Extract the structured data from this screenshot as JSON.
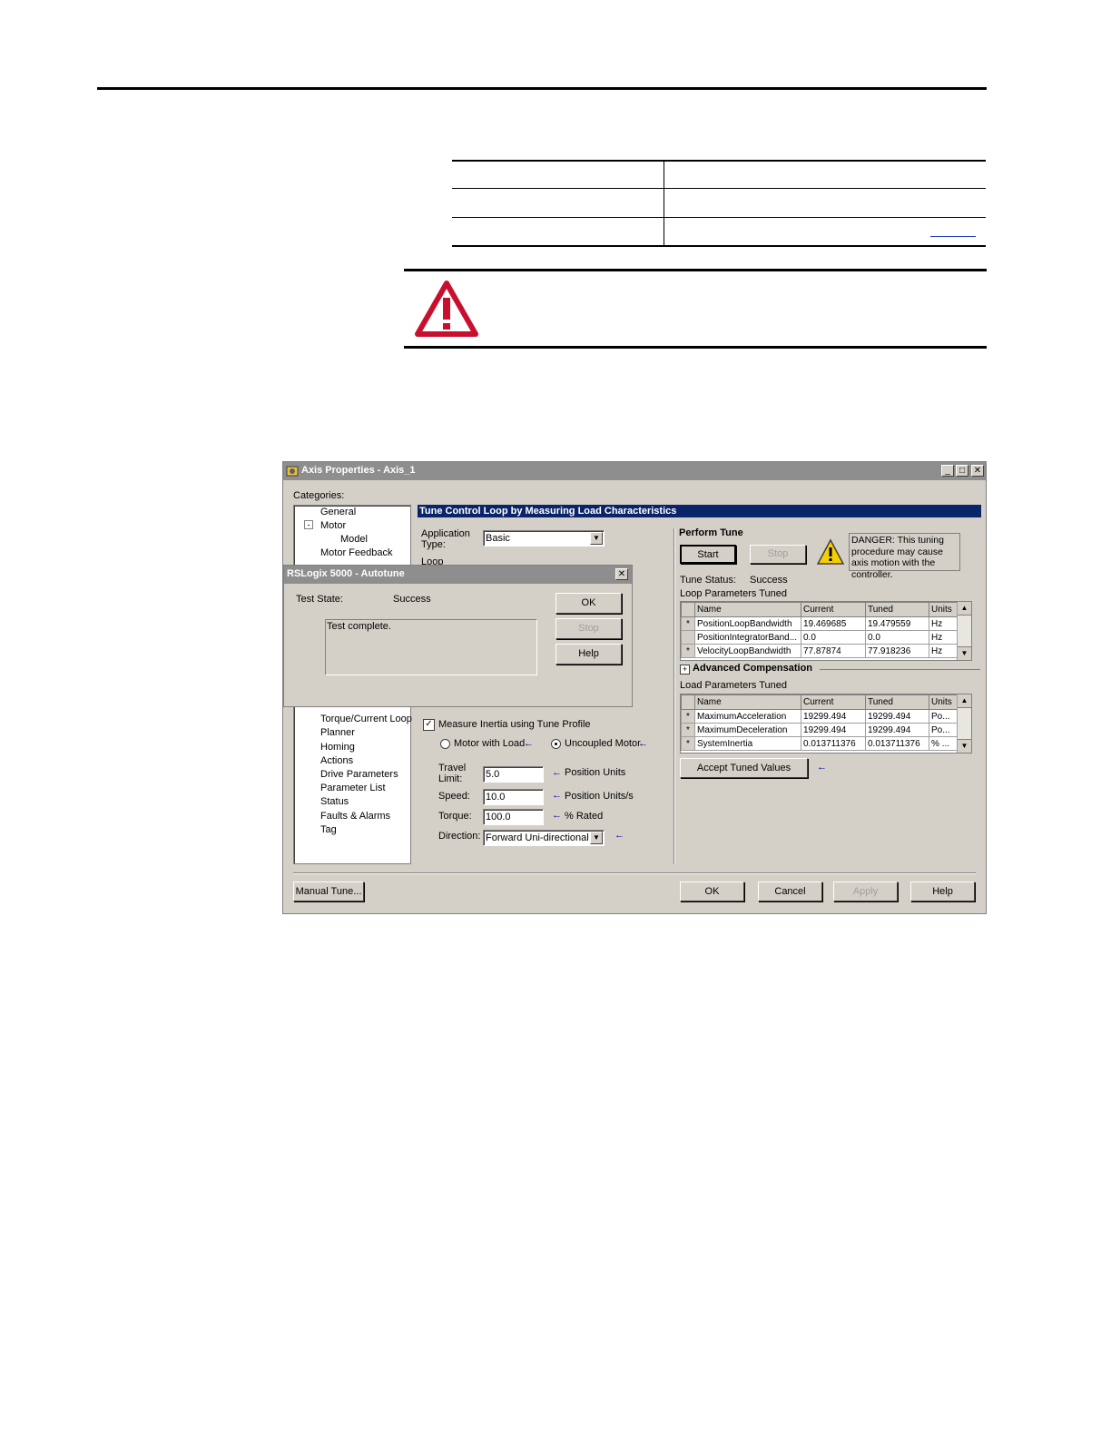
{
  "window": {
    "title": "Axis Properties - Axis_1",
    "categories_label": "Categories:",
    "categories": [
      "General",
      "Motor",
      "Model",
      "Motor Feedback",
      "Torque/Current Loop",
      "Planner",
      "Homing",
      "Actions",
      "Drive Parameters",
      "Parameter List",
      "Status",
      "Faults & Alarms",
      "Tag"
    ],
    "panel_title": "Tune Control Loop by Measuring Load Characteristics",
    "application_type_label": "Application Type:",
    "application_type_value": "Basic",
    "loop_label": "Loop",
    "measure_inertia_label": "Measure Inertia using Tune Profile",
    "motor_with_load": "Motor with Load",
    "uncoupled_motor": "Uncoupled Motor",
    "travel_limit_label": "Travel Limit:",
    "travel_limit_value": "5.0",
    "travel_limit_units": "Position Units",
    "speed_label": "Speed:",
    "speed_value": "10.0",
    "speed_units": "Position Units/s",
    "torque_label": "Torque:",
    "torque_value": "100.0",
    "torque_units": "% Rated",
    "direction_label": "Direction:",
    "direction_value": "Forward Uni-directional",
    "perform_tune": "Perform Tune",
    "start": "Start",
    "stop": "Stop",
    "danger_text": "DANGER: This tuning procedure may cause axis motion with the controller.",
    "tune_status_label": "Tune Status:",
    "tune_status_value": "Success",
    "loop_params_label": "Loop Parameters Tuned",
    "grid_headers": [
      "Name",
      "Current",
      "Tuned",
      "Units"
    ],
    "loop_rows": [
      {
        "mark": "*",
        "name": "PositionLoopBandwidth",
        "current": "19.469685",
        "tuned": "19.479559",
        "units": "Hz"
      },
      {
        "mark": "",
        "name": "PositionIntegratorBand...",
        "current": "0.0",
        "tuned": "0.0",
        "units": "Hz"
      },
      {
        "mark": "*",
        "name": "VelocityLoopBandwidth",
        "current": "77.87874",
        "tuned": "77.918236",
        "units": "Hz"
      }
    ],
    "advanced_compensation": "Advanced Compensation",
    "load_params_label": "Load Parameters Tuned",
    "load_rows": [
      {
        "mark": "*",
        "name": "MaximumAcceleration",
        "current": "19299.494",
        "tuned": "19299.494",
        "units": "Po..."
      },
      {
        "mark": "*",
        "name": "MaximumDeceleration",
        "current": "19299.494",
        "tuned": "19299.494",
        "units": "Po..."
      },
      {
        "mark": "*",
        "name": "SystemInertia",
        "current": "0.013711376",
        "tuned": "0.013711376",
        "units": "% ..."
      }
    ],
    "accept_tuned_values": "Accept Tuned Values",
    "manual_tune": "Manual Tune...",
    "ok": "OK",
    "cancel": "Cancel",
    "apply": "Apply",
    "help": "Help"
  },
  "dialog": {
    "title": "RSLogix 5000 - Autotune",
    "test_state_label": "Test State:",
    "test_state_value": "Success",
    "message": "Test complete.",
    "ok": "OK",
    "stop": "Stop",
    "help": "Help"
  }
}
